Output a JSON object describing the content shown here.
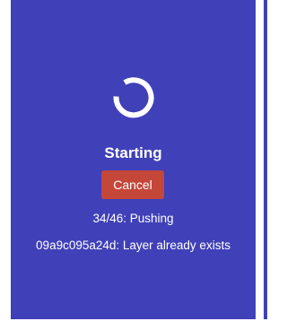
{
  "status": {
    "title": "Starting",
    "progress": "34/46: Pushing",
    "detail": "09a9c095a24d: Layer already exists"
  },
  "actions": {
    "cancel_label": "Cancel"
  },
  "spinner": {
    "icon": "loading-spinner-icon"
  },
  "colors": {
    "panel_background": "#4040b8",
    "button_background": "#c5473a",
    "text": "#ffffff"
  }
}
